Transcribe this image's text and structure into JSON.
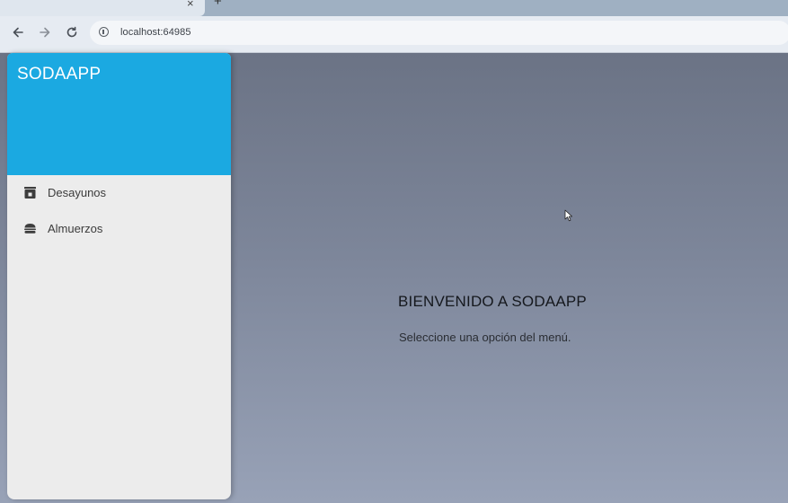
{
  "browser": {
    "tab_close": "×",
    "new_tab": "+",
    "url": "localhost:64985"
  },
  "icons": {
    "back": "arrow-left-icon",
    "forward": "arrow-right-icon",
    "reload": "reload-icon",
    "site_info": "info-icon",
    "desayunos": "storefront-icon",
    "almuerzos": "burger-icon"
  },
  "colors": {
    "header": "#1ba9e1",
    "drawer": "#ececec"
  },
  "drawer": {
    "app_title": "SODAAPP",
    "items": [
      {
        "label": "Desayunos",
        "icon": "storefront-icon"
      },
      {
        "label": "Almuerzos",
        "icon": "burger-icon"
      }
    ]
  },
  "main": {
    "title": "BIENVENIDO A SODAAPP",
    "subtitle": "Seleccione una opción del menú."
  }
}
